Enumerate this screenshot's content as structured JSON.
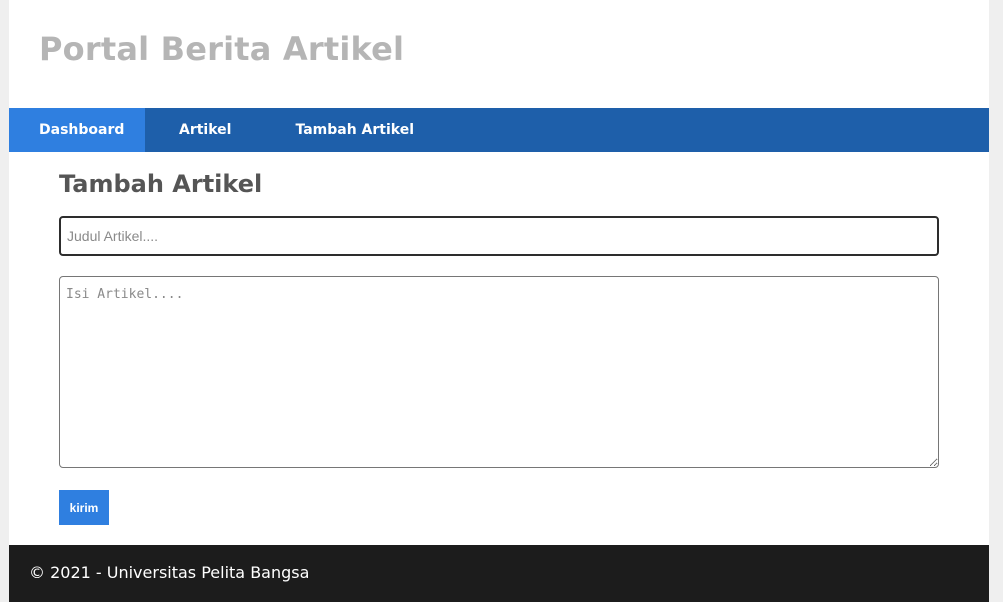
{
  "header": {
    "site_title": "Portal Berita Artikel"
  },
  "nav": {
    "items": [
      {
        "label": "Dashboard",
        "active": true
      },
      {
        "label": "Artikel",
        "active": false
      },
      {
        "label": "Tambah Artikel",
        "active": false
      }
    ]
  },
  "main": {
    "heading": "Tambah Artikel",
    "title_field": {
      "value": "",
      "placeholder": "Judul Artikel...."
    },
    "body_field": {
      "value": "",
      "placeholder": "Isi Artikel...."
    },
    "submit_label": "kirim"
  },
  "footer": {
    "text": "© 2021 - Universitas Pelita Bangsa"
  },
  "colors": {
    "nav_background": "#1e5faa",
    "nav_active": "#2f7fe0",
    "button": "#2f7fe0",
    "footer_background": "#1c1c1c",
    "site_title": "#b5b5b5",
    "heading": "#555555"
  }
}
